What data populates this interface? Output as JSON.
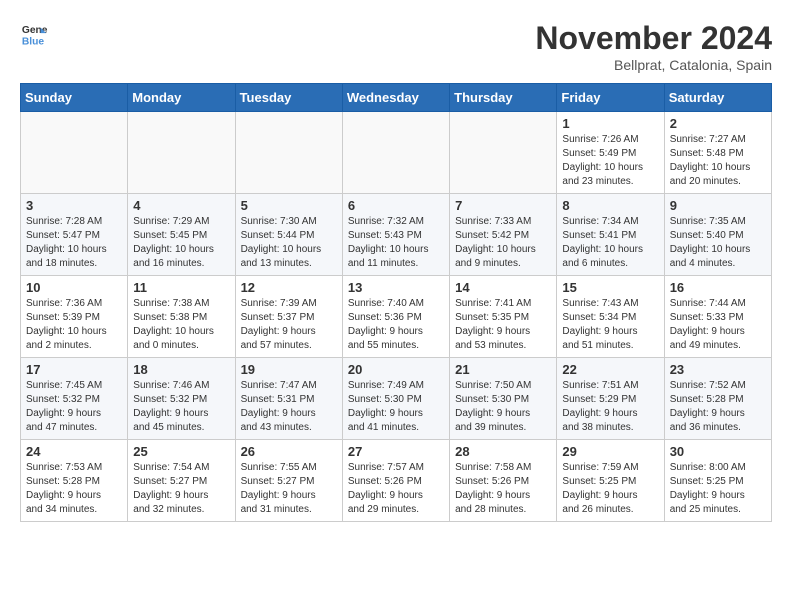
{
  "header": {
    "logo_line1": "General",
    "logo_line2": "Blue",
    "month_title": "November 2024",
    "subtitle": "Bellprat, Catalonia, Spain"
  },
  "days_of_week": [
    "Sunday",
    "Monday",
    "Tuesday",
    "Wednesday",
    "Thursday",
    "Friday",
    "Saturday"
  ],
  "weeks": [
    [
      {
        "day": "",
        "info": ""
      },
      {
        "day": "",
        "info": ""
      },
      {
        "day": "",
        "info": ""
      },
      {
        "day": "",
        "info": ""
      },
      {
        "day": "",
        "info": ""
      },
      {
        "day": "1",
        "info": "Sunrise: 7:26 AM\nSunset: 5:49 PM\nDaylight: 10 hours\nand 23 minutes."
      },
      {
        "day": "2",
        "info": "Sunrise: 7:27 AM\nSunset: 5:48 PM\nDaylight: 10 hours\nand 20 minutes."
      }
    ],
    [
      {
        "day": "3",
        "info": "Sunrise: 7:28 AM\nSunset: 5:47 PM\nDaylight: 10 hours\nand 18 minutes."
      },
      {
        "day": "4",
        "info": "Sunrise: 7:29 AM\nSunset: 5:45 PM\nDaylight: 10 hours\nand 16 minutes."
      },
      {
        "day": "5",
        "info": "Sunrise: 7:30 AM\nSunset: 5:44 PM\nDaylight: 10 hours\nand 13 minutes."
      },
      {
        "day": "6",
        "info": "Sunrise: 7:32 AM\nSunset: 5:43 PM\nDaylight: 10 hours\nand 11 minutes."
      },
      {
        "day": "7",
        "info": "Sunrise: 7:33 AM\nSunset: 5:42 PM\nDaylight: 10 hours\nand 9 minutes."
      },
      {
        "day": "8",
        "info": "Sunrise: 7:34 AM\nSunset: 5:41 PM\nDaylight: 10 hours\nand 6 minutes."
      },
      {
        "day": "9",
        "info": "Sunrise: 7:35 AM\nSunset: 5:40 PM\nDaylight: 10 hours\nand 4 minutes."
      }
    ],
    [
      {
        "day": "10",
        "info": "Sunrise: 7:36 AM\nSunset: 5:39 PM\nDaylight: 10 hours\nand 2 minutes."
      },
      {
        "day": "11",
        "info": "Sunrise: 7:38 AM\nSunset: 5:38 PM\nDaylight: 10 hours\nand 0 minutes."
      },
      {
        "day": "12",
        "info": "Sunrise: 7:39 AM\nSunset: 5:37 PM\nDaylight: 9 hours\nand 57 minutes."
      },
      {
        "day": "13",
        "info": "Sunrise: 7:40 AM\nSunset: 5:36 PM\nDaylight: 9 hours\nand 55 minutes."
      },
      {
        "day": "14",
        "info": "Sunrise: 7:41 AM\nSunset: 5:35 PM\nDaylight: 9 hours\nand 53 minutes."
      },
      {
        "day": "15",
        "info": "Sunrise: 7:43 AM\nSunset: 5:34 PM\nDaylight: 9 hours\nand 51 minutes."
      },
      {
        "day": "16",
        "info": "Sunrise: 7:44 AM\nSunset: 5:33 PM\nDaylight: 9 hours\nand 49 minutes."
      }
    ],
    [
      {
        "day": "17",
        "info": "Sunrise: 7:45 AM\nSunset: 5:32 PM\nDaylight: 9 hours\nand 47 minutes."
      },
      {
        "day": "18",
        "info": "Sunrise: 7:46 AM\nSunset: 5:32 PM\nDaylight: 9 hours\nand 45 minutes."
      },
      {
        "day": "19",
        "info": "Sunrise: 7:47 AM\nSunset: 5:31 PM\nDaylight: 9 hours\nand 43 minutes."
      },
      {
        "day": "20",
        "info": "Sunrise: 7:49 AM\nSunset: 5:30 PM\nDaylight: 9 hours\nand 41 minutes."
      },
      {
        "day": "21",
        "info": "Sunrise: 7:50 AM\nSunset: 5:30 PM\nDaylight: 9 hours\nand 39 minutes."
      },
      {
        "day": "22",
        "info": "Sunrise: 7:51 AM\nSunset: 5:29 PM\nDaylight: 9 hours\nand 38 minutes."
      },
      {
        "day": "23",
        "info": "Sunrise: 7:52 AM\nSunset: 5:28 PM\nDaylight: 9 hours\nand 36 minutes."
      }
    ],
    [
      {
        "day": "24",
        "info": "Sunrise: 7:53 AM\nSunset: 5:28 PM\nDaylight: 9 hours\nand 34 minutes."
      },
      {
        "day": "25",
        "info": "Sunrise: 7:54 AM\nSunset: 5:27 PM\nDaylight: 9 hours\nand 32 minutes."
      },
      {
        "day": "26",
        "info": "Sunrise: 7:55 AM\nSunset: 5:27 PM\nDaylight: 9 hours\nand 31 minutes."
      },
      {
        "day": "27",
        "info": "Sunrise: 7:57 AM\nSunset: 5:26 PM\nDaylight: 9 hours\nand 29 minutes."
      },
      {
        "day": "28",
        "info": "Sunrise: 7:58 AM\nSunset: 5:26 PM\nDaylight: 9 hours\nand 28 minutes."
      },
      {
        "day": "29",
        "info": "Sunrise: 7:59 AM\nSunset: 5:25 PM\nDaylight: 9 hours\nand 26 minutes."
      },
      {
        "day": "30",
        "info": "Sunrise: 8:00 AM\nSunset: 5:25 PM\nDaylight: 9 hours\nand 25 minutes."
      }
    ]
  ]
}
